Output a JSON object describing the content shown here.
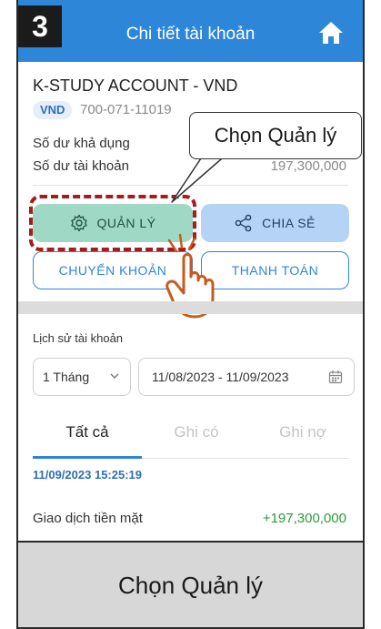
{
  "header": {
    "step": "3",
    "title": "Chi tiết tài khoản",
    "icon": "home-icon",
    "color": "#2d86d8"
  },
  "account": {
    "name": "K-STUDY ACCOUNT - VND",
    "currency": "VND",
    "number": "700-071-11019",
    "available_label": "Số dư khả dụng",
    "balance_label": "Số dư tài khoản",
    "balance_value": "197,300,000"
  },
  "actions": {
    "manage_label": "QUẢN LÝ",
    "manage_icon": "gear-icon",
    "share_label": "CHIA SẺ",
    "share_icon": "share-icon",
    "transfer_label": "CHUYỂN KHOẢN",
    "pay_label": "THANH TOÁN"
  },
  "history": {
    "title": "Lịch sử tài khoản",
    "period": "1 Tháng",
    "date_range": "11/08/2023 - 11/09/2023",
    "tabs": [
      "Tất cả",
      "Ghi có",
      "Ghi nợ"
    ],
    "active_tab": "Tất cả",
    "transactions": [
      {
        "datetime": "11/09/2023 15:25:19",
        "name": "Giao dịch tiền mặt",
        "amount": "+197,300,000"
      }
    ]
  },
  "annotation": {
    "callout": "Chọn Quản lý",
    "caption": "Chọn Quản lý",
    "highlight_color": "#a41d1d"
  }
}
